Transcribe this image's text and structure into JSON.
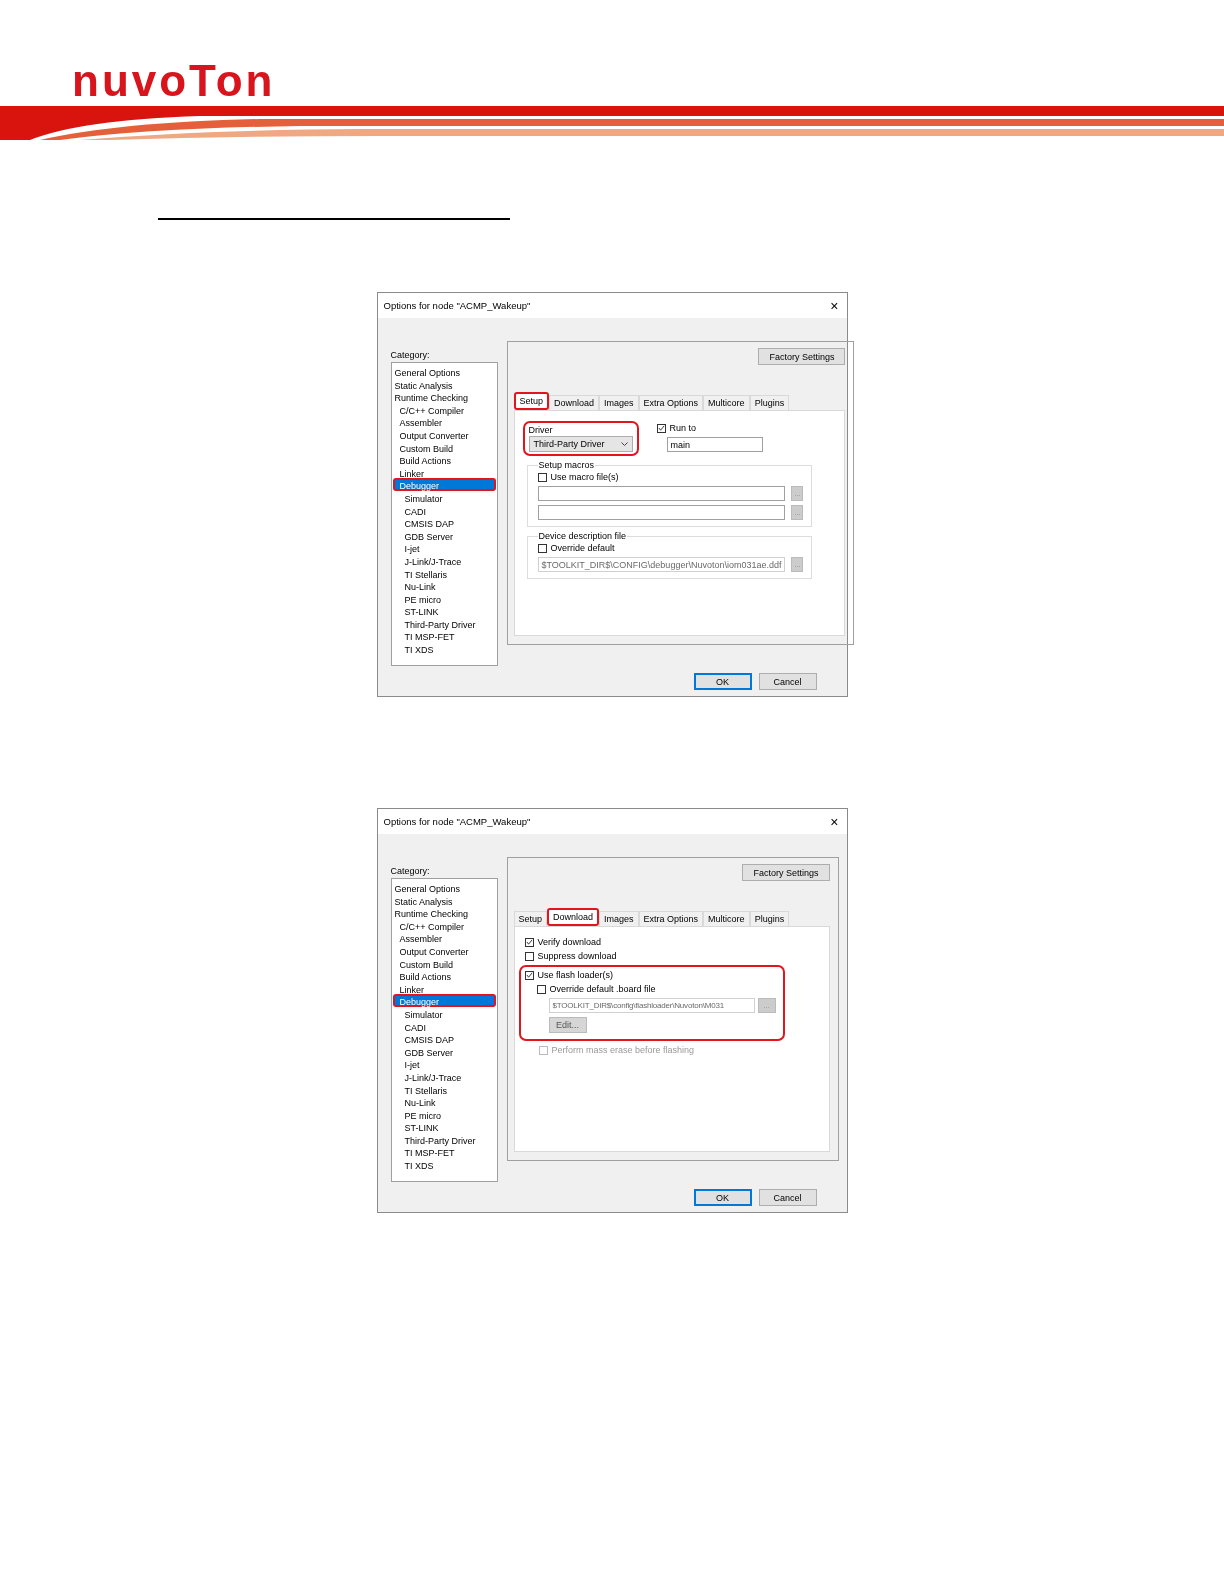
{
  "header": {
    "logo": "nuvoTon"
  },
  "dialogs": [
    {
      "title": "Options for node \"ACMP_Wakeup\"",
      "close": "×",
      "category_label": "Category:",
      "categories": [
        {
          "label": "General Options",
          "kind": "general",
          "selected": false,
          "highlighted": false
        },
        {
          "label": "Static Analysis",
          "kind": "general",
          "selected": false,
          "highlighted": false
        },
        {
          "label": "Runtime Checking",
          "kind": "general",
          "selected": false,
          "highlighted": false
        },
        {
          "label": "C/C++ Compiler",
          "kind": "tool",
          "selected": false,
          "highlighted": false
        },
        {
          "label": "Assembler",
          "kind": "tool",
          "selected": false,
          "highlighted": false
        },
        {
          "label": "Output Converter",
          "kind": "tool",
          "selected": false,
          "highlighted": false
        },
        {
          "label": "Custom Build",
          "kind": "tool",
          "selected": false,
          "highlighted": false
        },
        {
          "label": "Build Actions",
          "kind": "tool",
          "selected": false,
          "highlighted": false
        },
        {
          "label": "Linker",
          "kind": "tool",
          "selected": false,
          "highlighted": false
        },
        {
          "label": "Debugger",
          "kind": "tool",
          "selected": true,
          "highlighted": true,
          "children": [
            {
              "label": "Simulator",
              "selected": false,
              "highlighted": false
            },
            {
              "label": "CADI",
              "selected": false,
              "highlighted": false
            },
            {
              "label": "CMSIS DAP",
              "selected": false,
              "highlighted": false
            },
            {
              "label": "GDB Server",
              "selected": false,
              "highlighted": false
            },
            {
              "label": "I-jet",
              "selected": false,
              "highlighted": false
            },
            {
              "label": "J-Link/J-Trace",
              "selected": false,
              "highlighted": false
            },
            {
              "label": "TI Stellaris",
              "selected": false,
              "highlighted": false
            },
            {
              "label": "Nu-Link",
              "selected": false,
              "highlighted": false
            },
            {
              "label": "PE micro",
              "selected": false,
              "highlighted": false
            },
            {
              "label": "ST-LINK",
              "selected": false,
              "highlighted": false
            },
            {
              "label": "Third-Party Driver",
              "selected": false,
              "highlighted": false
            },
            {
              "label": "TI MSP-FET",
              "selected": false,
              "highlighted": false
            },
            {
              "label": "TI XDS",
              "selected": false,
              "highlighted": false
            }
          ]
        }
      ],
      "factory_button": "Factory Settings",
      "tabs": [
        {
          "label": "Setup",
          "selected": true,
          "highlighted": true
        },
        {
          "label": "Download",
          "selected": false,
          "highlighted": false
        },
        {
          "label": "Images",
          "selected": false,
          "highlighted": false
        },
        {
          "label": "Extra Options",
          "selected": false,
          "highlighted": false
        },
        {
          "label": "Multicore",
          "selected": false,
          "highlighted": false
        },
        {
          "label": "Plugins",
          "selected": false,
          "highlighted": false
        }
      ],
      "page": {
        "kind": "setup",
        "driver": {
          "label": "Driver",
          "value": "Third-Party Driver",
          "highlighted": true
        },
        "run_to": {
          "label": "Run to",
          "checked": true,
          "value": "main"
        },
        "setup_macros": {
          "title": "Setup macros",
          "checkbox": {
            "label": "Use macro file(s)",
            "checked": false
          },
          "browse": [
            "...",
            "..."
          ]
        },
        "device_description": {
          "title": "Device description file",
          "checkbox": {
            "label": "Override default",
            "checked": false
          },
          "value": "$TOOLKIT_DIR$\\CONFIG\\debugger\\Nuvoton\\iom031ae.ddf",
          "browse": "..."
        }
      },
      "buttons": [
        {
          "label": "OK",
          "kind": "default"
        },
        {
          "label": "Cancel",
          "kind": "normal"
        }
      ]
    },
    {
      "title": "Options for node \"ACMP_Wakeup\"",
      "close": "×",
      "category_label": "Category:",
      "categories": [
        {
          "label": "General Options",
          "kind": "general",
          "selected": false,
          "highlighted": false
        },
        {
          "label": "Static Analysis",
          "kind": "general",
          "selected": false,
          "highlighted": false
        },
        {
          "label": "Runtime Checking",
          "kind": "general",
          "selected": false,
          "highlighted": false
        },
        {
          "label": "C/C++ Compiler",
          "kind": "tool",
          "selected": false,
          "highlighted": false
        },
        {
          "label": "Assembler",
          "kind": "tool",
          "selected": false,
          "highlighted": false
        },
        {
          "label": "Output Converter",
          "kind": "tool",
          "selected": false,
          "highlighted": false
        },
        {
          "label": "Custom Build",
          "kind": "tool",
          "selected": false,
          "highlighted": false
        },
        {
          "label": "Build Actions",
          "kind": "tool",
          "selected": false,
          "highlighted": false
        },
        {
          "label": "Linker",
          "kind": "tool",
          "selected": false,
          "highlighted": false
        },
        {
          "label": "Debugger",
          "kind": "tool",
          "selected": true,
          "highlighted": true,
          "children": [
            {
              "label": "Simulator",
              "selected": false,
              "highlighted": false
            },
            {
              "label": "CADI",
              "selected": false,
              "highlighted": false
            },
            {
              "label": "CMSIS DAP",
              "selected": false,
              "highlighted": false
            },
            {
              "label": "GDB Server",
              "selected": false,
              "highlighted": false
            },
            {
              "label": "I-jet",
              "selected": false,
              "highlighted": false
            },
            {
              "label": "J-Link/J-Trace",
              "selected": false,
              "highlighted": false
            },
            {
              "label": "TI Stellaris",
              "selected": false,
              "highlighted": false
            },
            {
              "label": "Nu-Link",
              "selected": false,
              "highlighted": false
            },
            {
              "label": "PE micro",
              "selected": false,
              "highlighted": false
            },
            {
              "label": "ST-LINK",
              "selected": false,
              "highlighted": false
            },
            {
              "label": "Third-Party Driver",
              "selected": false,
              "highlighted": false
            },
            {
              "label": "TI MSP-FET",
              "selected": false,
              "highlighted": false
            },
            {
              "label": "TI XDS",
              "selected": false,
              "highlighted": false
            }
          ]
        }
      ],
      "factory_button": "Factory Settings",
      "tabs": [
        {
          "label": "Setup",
          "selected": false,
          "highlighted": false
        },
        {
          "label": "Download",
          "selected": true,
          "highlighted": true
        },
        {
          "label": "Images",
          "selected": false,
          "highlighted": false
        },
        {
          "label": "Extra Options",
          "selected": false,
          "highlighted": false
        },
        {
          "label": "Multicore",
          "selected": false,
          "highlighted": false
        },
        {
          "label": "Plugins",
          "selected": false,
          "highlighted": false
        }
      ],
      "page": {
        "kind": "download",
        "verify": {
          "label": "Verify download",
          "checked": true
        },
        "suppress": {
          "label": "Suppress download",
          "checked": false
        },
        "flash": {
          "highlighted": true,
          "checkbox": {
            "label": "Use flash loader(s)",
            "checked": true
          },
          "override": {
            "label": "Override default .board file",
            "checked": false
          },
          "value": "$TOOLKIT_DIR$\\config\\flashloader\\Nuvoton\\M031",
          "browse": "...",
          "edit": "Edit..."
        },
        "mass_erase": {
          "label": "Perform mass erase before flashing",
          "checked": false,
          "disabled": true
        }
      },
      "buttons": [
        {
          "label": "OK",
          "kind": "default"
        },
        {
          "label": "Cancel",
          "kind": "normal"
        }
      ]
    }
  ]
}
